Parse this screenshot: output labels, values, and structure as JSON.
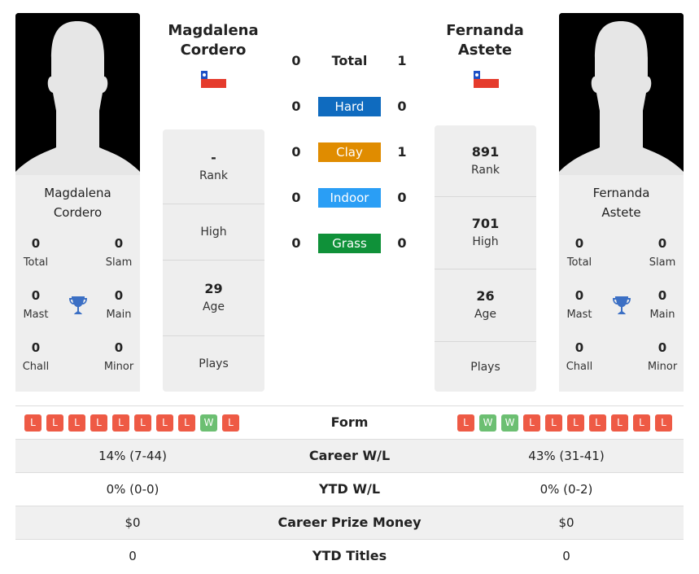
{
  "player1": {
    "name_line1": "Magdalena",
    "name_line2": "Cordero",
    "country_flag": "chile-flag",
    "titles": {
      "total": {
        "value": "0",
        "label": "Total"
      },
      "slam": {
        "value": "0",
        "label": "Slam"
      },
      "mast": {
        "value": "0",
        "label": "Mast"
      },
      "main": {
        "value": "0",
        "label": "Main"
      },
      "chall": {
        "value": "0",
        "label": "Chall"
      },
      "minor": {
        "value": "0",
        "label": "Minor"
      }
    },
    "stats": {
      "rank": {
        "value": "-",
        "label": "Rank"
      },
      "high": {
        "value": "",
        "label": "High"
      },
      "age": {
        "value": "29",
        "label": "Age"
      },
      "plays": {
        "value": "",
        "label": "Plays"
      }
    },
    "form": [
      "L",
      "L",
      "L",
      "L",
      "L",
      "L",
      "L",
      "L",
      "W",
      "L"
    ]
  },
  "player2": {
    "name_line1": "Fernanda",
    "name_line2": "Astete",
    "country_flag": "chile-flag",
    "titles": {
      "total": {
        "value": "0",
        "label": "Total"
      },
      "slam": {
        "value": "0",
        "label": "Slam"
      },
      "mast": {
        "value": "0",
        "label": "Mast"
      },
      "main": {
        "value": "0",
        "label": "Main"
      },
      "chall": {
        "value": "0",
        "label": "Chall"
      },
      "minor": {
        "value": "0",
        "label": "Minor"
      }
    },
    "stats": {
      "rank": {
        "value": "891",
        "label": "Rank"
      },
      "high": {
        "value": "701",
        "label": "High"
      },
      "age": {
        "value": "26",
        "label": "Age"
      },
      "plays": {
        "value": "",
        "label": "Plays"
      }
    },
    "form": [
      "L",
      "W",
      "W",
      "L",
      "L",
      "L",
      "L",
      "L",
      "L",
      "L"
    ]
  },
  "h2h": [
    {
      "label": "Total",
      "p1": "0",
      "p2": "1",
      "color": ""
    },
    {
      "label": "Hard",
      "p1": "0",
      "p2": "0",
      "color": "#0f6bbf"
    },
    {
      "label": "Clay",
      "p1": "0",
      "p2": "1",
      "color": "#e08c00"
    },
    {
      "label": "Indoor",
      "p1": "0",
      "p2": "0",
      "color": "#2a9ef5"
    },
    {
      "label": "Grass",
      "p1": "0",
      "p2": "0",
      "color": "#0f9139"
    }
  ],
  "table": {
    "form_label": "Form",
    "rows": [
      {
        "p1": "14% (7-44)",
        "label": "Career W/L",
        "p2": "43% (31-41)"
      },
      {
        "p1": "0% (0-0)",
        "label": "YTD W/L",
        "p2": "0% (0-2)"
      },
      {
        "p1": "$0",
        "label": "Career Prize Money",
        "p2": "$0"
      },
      {
        "p1": "0",
        "label": "YTD Titles",
        "p2": "0"
      }
    ]
  }
}
